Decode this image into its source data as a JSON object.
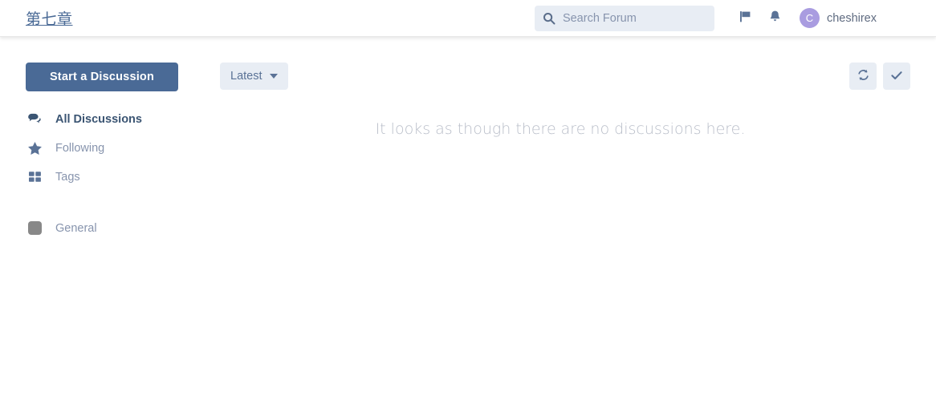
{
  "header": {
    "forum_title": "第七章",
    "search": {
      "placeholder": "Search Forum",
      "value": "",
      "icon": "search-icon"
    },
    "flag_icon": "flag-icon",
    "notifications_icon": "bell-icon",
    "user": {
      "avatar_letter": "C",
      "avatar_color": "#a99ce0",
      "username": "cheshirex"
    }
  },
  "toolbar": {
    "start_discussion_label": "Start a Discussion",
    "sort_label": "Latest",
    "sort_caret_icon": "chevron-down-icon",
    "refresh_icon": "refresh-icon",
    "mark_all_read_icon": "check-icon"
  },
  "sidebar": {
    "items": [
      {
        "label": "All Discussions",
        "icon": "discussions-icon",
        "active": true
      },
      {
        "label": "Following",
        "icon": "star-icon",
        "active": false
      },
      {
        "label": "Tags",
        "icon": "tags-grid-icon",
        "active": false
      }
    ],
    "tags": [
      {
        "label": "General",
        "color": "#888888"
      }
    ]
  },
  "main": {
    "empty_state_message": "It looks as though there are no discussions here."
  },
  "colors": {
    "primary": "#4a6a96",
    "muted": "#8794ad",
    "control_bg": "#e8edf4"
  }
}
